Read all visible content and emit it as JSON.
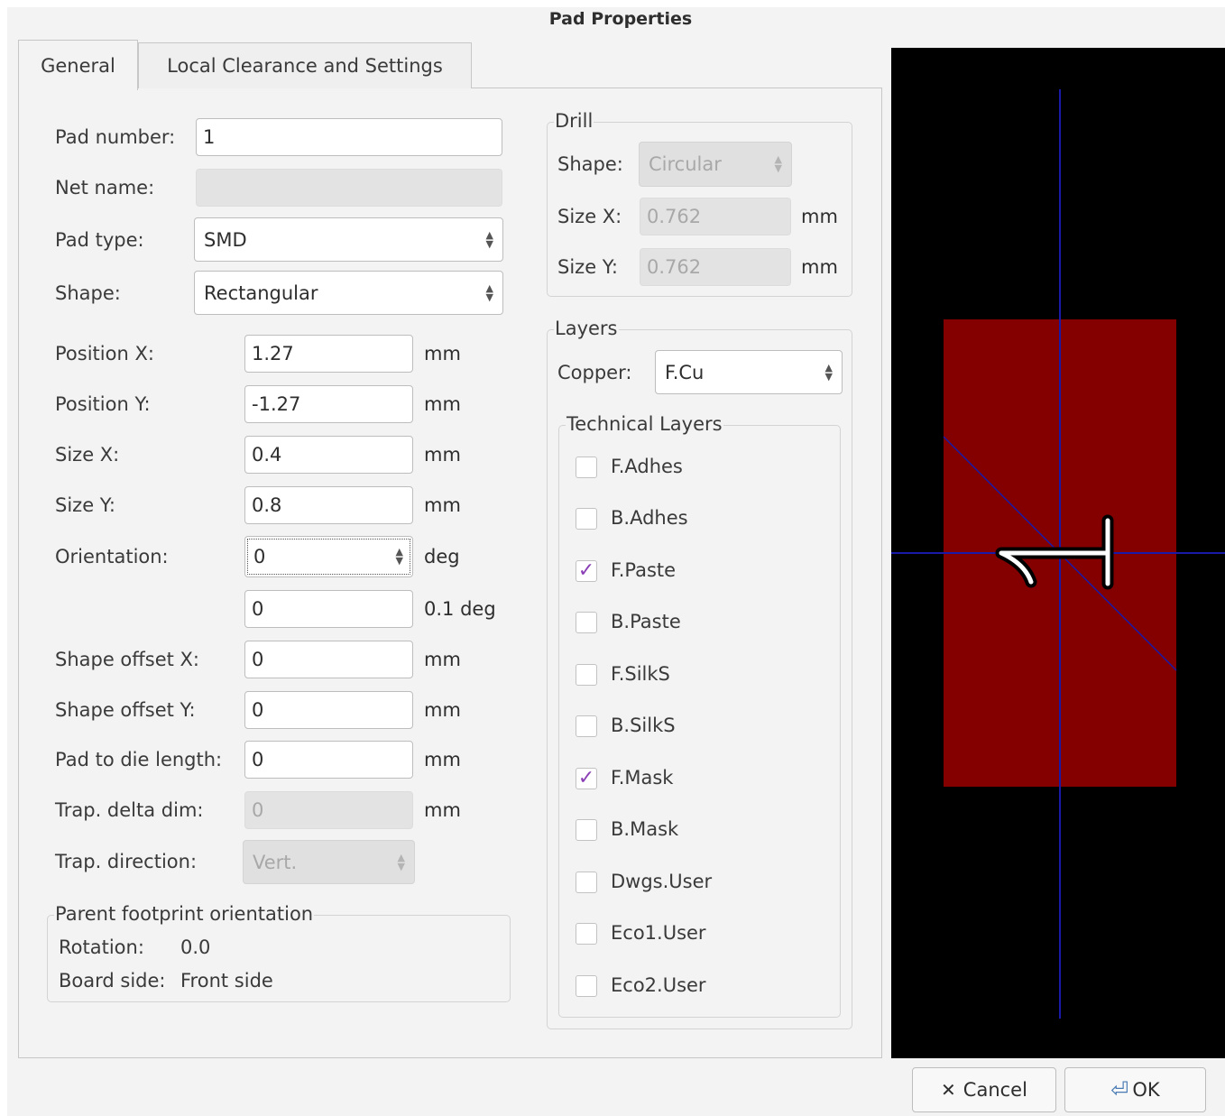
{
  "window": {
    "title": "Pad Properties"
  },
  "tabs": [
    {
      "label": "General",
      "active": true
    },
    {
      "label": "Local Clearance and Settings",
      "active": false
    }
  ],
  "general": {
    "pad_number": {
      "label": "Pad number:",
      "value": "1"
    },
    "net_name": {
      "label": "Net name:",
      "value": ""
    },
    "pad_type": {
      "label": "Pad type:",
      "value": "SMD"
    },
    "shape": {
      "label": "Shape:",
      "value": "Rectangular"
    },
    "position_x": {
      "label": "Position X:",
      "value": "1.27",
      "unit": "mm"
    },
    "position_y": {
      "label": "Position Y:",
      "value": "-1.27",
      "unit": "mm"
    },
    "size_x": {
      "label": "Size X:",
      "value": "0.4",
      "unit": "mm"
    },
    "size_y": {
      "label": "Size Y:",
      "value": "0.8",
      "unit": "mm"
    },
    "orientation": {
      "label": "Orientation:",
      "value": "0",
      "unit": "deg"
    },
    "orientation_fine": {
      "value": "0",
      "unit": "0.1 deg"
    },
    "shape_offset_x": {
      "label": "Shape offset X:",
      "value": "0",
      "unit": "mm"
    },
    "shape_offset_y": {
      "label": "Shape offset Y:",
      "value": "0",
      "unit": "mm"
    },
    "pad_to_die": {
      "label": "Pad to die length:",
      "value": "0",
      "unit": "mm"
    },
    "trap_delta": {
      "label": "Trap. delta dim:",
      "value": "0",
      "unit": "mm"
    },
    "trap_direction": {
      "label": "Trap. direction:",
      "value": "Vert."
    },
    "parent_footprint": {
      "title": "Parent footprint orientation",
      "rotation_label": "Rotation:",
      "rotation_value": "0.0",
      "board_side_label": "Board side:",
      "board_side_value": "Front side"
    }
  },
  "drill": {
    "title": "Drill",
    "shape_label": "Shape:",
    "shape_value": "Circular",
    "size_x_label": "Size X:",
    "size_x_value": "0.762",
    "size_y_label": "Size Y:",
    "size_y_value": "0.762",
    "unit": "mm"
  },
  "layers": {
    "title": "Layers",
    "copper_label": "Copper:",
    "copper_value": "F.Cu",
    "technical_title": "Technical Layers",
    "items": [
      {
        "label": "F.Adhes",
        "checked": false
      },
      {
        "label": "B.Adhes",
        "checked": false
      },
      {
        "label": "F.Paste",
        "checked": true
      },
      {
        "label": "B.Paste",
        "checked": false
      },
      {
        "label": "F.SilkS",
        "checked": false
      },
      {
        "label": "B.SilkS",
        "checked": false
      },
      {
        "label": "F.Mask",
        "checked": true
      },
      {
        "label": "B.Mask",
        "checked": false
      },
      {
        "label": "Dwgs.User",
        "checked": false
      },
      {
        "label": "Eco1.User",
        "checked": false
      },
      {
        "label": "Eco2.User",
        "checked": false
      }
    ]
  },
  "preview": {
    "background": "#000000",
    "pad_color": "#840000",
    "axis_color": "#1a1aa8"
  },
  "buttons": {
    "cancel_label": "Cancel",
    "ok_label": "OK"
  },
  "icons": {
    "cancel": "close-icon",
    "ok": "enter-icon",
    "spin": "spin-arrows-icon",
    "check": "checkmark-icon"
  },
  "colors": {
    "check_accent": "#8b3fb5"
  }
}
